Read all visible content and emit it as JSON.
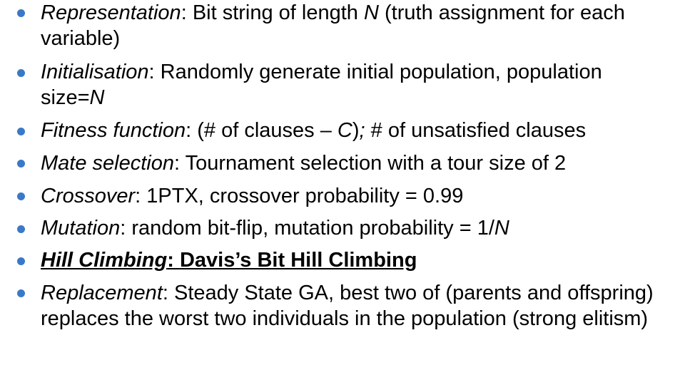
{
  "colors": {
    "bullet": "#3a79c8",
    "text": "#000000",
    "background": "#ffffff"
  },
  "bullets": [
    {
      "term": "Representation",
      "sep": ": ",
      "text_a": "Bit string of length ",
      "var": "N",
      "text_b": " (truth assignment for each variable)"
    },
    {
      "term": "Initialisation",
      "sep": ": ",
      "text_a": "Randomly generate initial population, population size=",
      "var": "N",
      "text_b": ""
    },
    {
      "term": "Fitness function",
      "sep": ": ",
      "text_a": "(# of clauses – ",
      "var": "C",
      "text_b": ")",
      "semi": ";",
      "text_c": " # of unsatisfied clauses"
    },
    {
      "term": "Mate selection",
      "sep": ": ",
      "text_a": "Tournament selection with a tour size of 2"
    },
    {
      "term": "Crossover",
      "sep": ": ",
      "text_a": "1PTX, crossover probability = 0.99"
    },
    {
      "term": "Mutation",
      "sep": ": ",
      "text_a": "random bit-flip, mutation probability = 1/",
      "var": "N"
    },
    {
      "term": "Hill Climbing",
      "sep": ": ",
      "text_a": "Davis’s Bit Hill Climbing"
    },
    {
      "term": "Replacement",
      "sep": ": ",
      "text_a": "Steady State GA, best two of (parents and offspring) replaces the worst two individuals in the population (strong elitism)"
    }
  ]
}
